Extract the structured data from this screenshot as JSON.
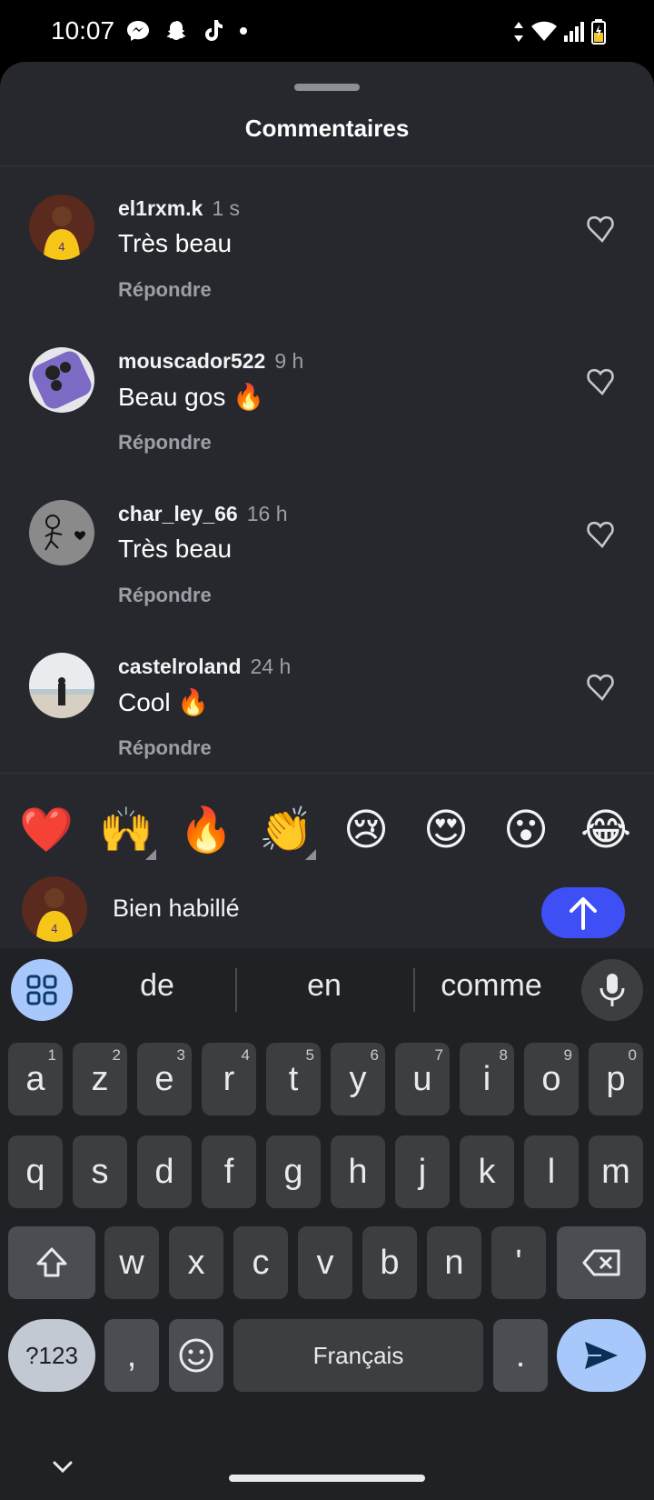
{
  "status_bar": {
    "time": "10:07",
    "left_icons": [
      "messenger-icon",
      "snapchat-icon",
      "tiktok-icon",
      "dot-icon"
    ],
    "right_icons": [
      "data-arrows-icon",
      "wifi-icon",
      "signal-icon",
      "battery-charging-icon"
    ]
  },
  "sheet": {
    "title": "Commentaires"
  },
  "comments": [
    {
      "username": "el1rxm.k",
      "time": "1 s",
      "text": "Très beau",
      "reply_label": "Répondre"
    },
    {
      "username": "mouscador522",
      "time": "9 h",
      "text": "Beau gos 🔥",
      "reply_label": "Répondre"
    },
    {
      "username": "char_ley_66",
      "time": "16 h",
      "text": "Très beau",
      "reply_label": "Répondre"
    },
    {
      "username": "castelroland",
      "time": "24 h",
      "text": "Cool 🔥",
      "reply_label": "Répondre"
    }
  ],
  "quick_emojis": [
    "❤️",
    "🙌",
    "🔥",
    "👏",
    "😢",
    "😍",
    "😮",
    "😂"
  ],
  "composer": {
    "input_value": "Bien habillé"
  },
  "keyboard": {
    "suggestions": [
      "de",
      "en",
      "comme"
    ],
    "row1": [
      {
        "k": "a",
        "s": "1"
      },
      {
        "k": "z",
        "s": "2"
      },
      {
        "k": "e",
        "s": "3"
      },
      {
        "k": "r",
        "s": "4"
      },
      {
        "k": "t",
        "s": "5"
      },
      {
        "k": "y",
        "s": "6"
      },
      {
        "k": "u",
        "s": "7"
      },
      {
        "k": "i",
        "s": "8"
      },
      {
        "k": "o",
        "s": "9"
      },
      {
        "k": "p",
        "s": "0"
      }
    ],
    "row2": [
      "q",
      "s",
      "d",
      "f",
      "g",
      "h",
      "j",
      "k",
      "l",
      "m"
    ],
    "row3": [
      "w",
      "x",
      "c",
      "v",
      "b",
      "n",
      "'"
    ],
    "symbols_label": "?123",
    "comma_label": ",",
    "space_label": "Français",
    "period_label": "."
  },
  "colors": {
    "sheet_bg": "#26282d",
    "send_button": "#3d4ff5",
    "keyboard_bg": "#202124",
    "key_bg": "#3c3e42",
    "accent": "#a8c7fa"
  }
}
